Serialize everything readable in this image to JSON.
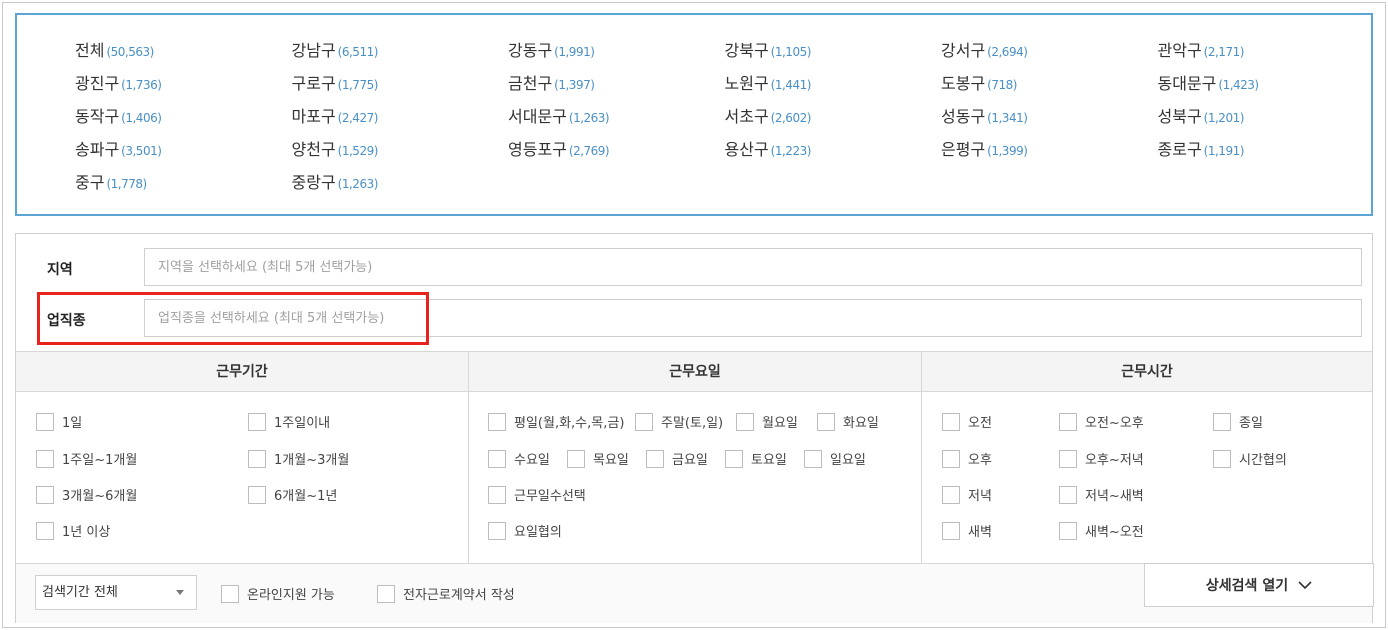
{
  "districts": [
    {
      "name": "전체",
      "count": "(50,563)"
    },
    {
      "name": "강남구",
      "count": "(6,511)"
    },
    {
      "name": "강동구",
      "count": "(1,991)"
    },
    {
      "name": "강북구",
      "count": "(1,105)"
    },
    {
      "name": "강서구",
      "count": "(2,694)"
    },
    {
      "name": "관악구",
      "count": "(2,171)"
    },
    {
      "name": "광진구",
      "count": "(1,736)"
    },
    {
      "name": "구로구",
      "count": "(1,775)"
    },
    {
      "name": "금천구",
      "count": "(1,397)"
    },
    {
      "name": "노원구",
      "count": "(1,441)"
    },
    {
      "name": "도봉구",
      "count": "(718)"
    },
    {
      "name": "동대문구",
      "count": "(1,423)"
    },
    {
      "name": "동작구",
      "count": "(1,406)"
    },
    {
      "name": "마포구",
      "count": "(2,427)"
    },
    {
      "name": "서대문구",
      "count": "(1,263)"
    },
    {
      "name": "서초구",
      "count": "(2,602)"
    },
    {
      "name": "성동구",
      "count": "(1,341)"
    },
    {
      "name": "성북구",
      "count": "(1,201)"
    },
    {
      "name": "송파구",
      "count": "(3,501)"
    },
    {
      "name": "양천구",
      "count": "(1,529)"
    },
    {
      "name": "영등포구",
      "count": "(2,769)"
    },
    {
      "name": "용산구",
      "count": "(1,223)"
    },
    {
      "name": "은평구",
      "count": "(1,399)"
    },
    {
      "name": "종로구",
      "count": "(1,191)"
    },
    {
      "name": "중구",
      "count": "(1,778)"
    },
    {
      "name": "중랑구",
      "count": "(1,263)"
    }
  ],
  "filters": {
    "region": {
      "label": "지역",
      "placeholder": "지역을 선택하세요 (최대 5개 선택가능)"
    },
    "job": {
      "label": "업직종",
      "placeholder": "업직종을 선택하세요 (최대 5개 선택가능)"
    }
  },
  "period": {
    "title": "근무기간",
    "options": [
      "1일",
      "1주일이내",
      "1주일~1개월",
      "1개월~3개월",
      "3개월~6개월",
      "6개월~1년",
      "1년 이상"
    ]
  },
  "days": {
    "title": "근무요일",
    "options": [
      "평일(월,화,수,목,금)",
      "주말(토,일)",
      "월요일",
      "화요일",
      "수요일",
      "목요일",
      "금요일",
      "토요일",
      "일요일",
      "근무일수선택",
      "요일협의"
    ]
  },
  "time": {
    "title": "근무시간",
    "options": [
      "오전",
      "오전~오후",
      "종일",
      "오후",
      "오후~저녁",
      "시간협의",
      "저녁",
      "저녁~새벽",
      "새벽",
      "새벽~오전"
    ]
  },
  "bottom": {
    "period_select": "검색기간 전체",
    "online": "온라인지원 가능",
    "contract": "전자근로계약서 작성",
    "advanced": "상세검색 열기"
  },
  "colors": {
    "district_border": "#5aa5d3",
    "count_text": "#4a90c6",
    "highlight": "#e8221c"
  }
}
